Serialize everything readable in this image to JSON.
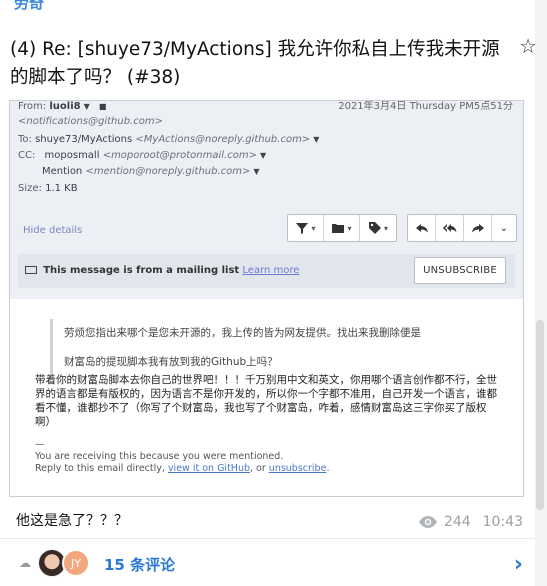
{
  "post": {
    "author_tag": "劳奇",
    "title": "(4) Re: [shuye73/MyActions] 我允许你私自上传我未开源的脚本了吗？ (#38)"
  },
  "email": {
    "date": "2021年3月4日 Thursday PM5点51分",
    "from_label": "From:",
    "from_name": "luoli8",
    "from_email": "<notifications@github.com>",
    "to_label": "To:",
    "to_name": "shuye73/MyActions",
    "to_email": "<MyActions@noreply.github.com>",
    "cc_label": "CC:",
    "cc_name": "moposmall",
    "cc_email": "<moporoot@protonmail.com>",
    "cc2_name": "Mention",
    "cc2_email": "<mention@noreply.github.com>",
    "size_label": "Size:",
    "size_value": "1.1 KB",
    "hide_details": "Hide details",
    "mailing_list_text": "This message is from a mailing list",
    "learn_more": "Learn more",
    "unsubscribe_btn": "UNSUBSCRIBE",
    "quote_line1": "劳烦您指出来哪个是您未开源的，我上传的皆为网友提供。找出来我删除便是",
    "quote_line2": "财富岛的提现脚本我有放到我的Github上吗？",
    "reply": "带着你的财富岛脚本去你自己的世界吧！！！千万别用中文和英文，你用哪个语言创作都不行，全世界的语言都是有版权的，因为语言不是你开发的，所以你一个字都不准用，自己开发一个语言，谁都看不懂，谁都抄不了（你写了个财富岛，我也写了个财富岛，咋着，感情财富岛这三字你买了版权啊）",
    "footer_dash": "—",
    "footer_line1": "You are receiving this because you were mentioned.",
    "footer_line2_pre": "Reply to this email directly,",
    "footer_link1": "view it on GitHub",
    "footer_mid": ", or",
    "footer_link2": "unsubscribe",
    "footer_end": "."
  },
  "comment": {
    "text": "他这是急了？？？",
    "views": "244",
    "time": "10:43"
  },
  "bottom": {
    "avatar2_initials": "JY",
    "comments_link": "15 条评论"
  },
  "icons": [
    "star-icon",
    "filter-icon",
    "folder-icon",
    "tag-icon",
    "reply-icon",
    "reply-all-icon",
    "forward-icon",
    "more-chevron-icon",
    "mailing-list-icon",
    "eye-icon",
    "cloud-icon",
    "chevron-right-icon"
  ]
}
